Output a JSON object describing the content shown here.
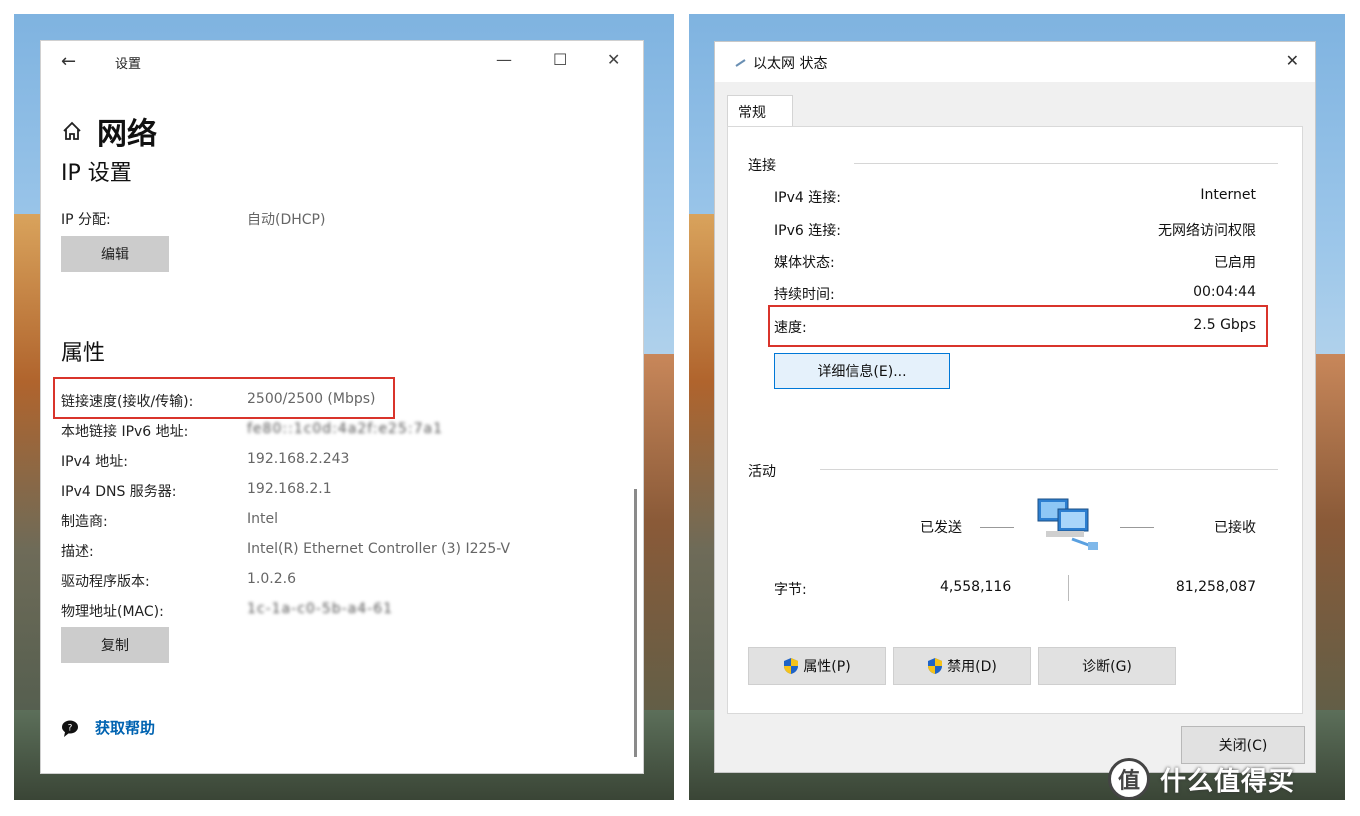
{
  "settings": {
    "title": "设置",
    "heading": "网络",
    "subheading": "IP 设置",
    "ip_assign": {
      "label": "IP 分配:",
      "value": "自动(DHCP)"
    },
    "edit_button": "编辑",
    "properties_heading": "属性",
    "props": [
      {
        "label": "链接速度(接收/传输):",
        "value": "2500/2500 (Mbps)"
      },
      {
        "label": "本地链接 IPv6 地址:",
        "value": "fe80::1c0d:4a2f:e25:7a1"
      },
      {
        "label": "IPv4 地址:",
        "value": "192.168.2.243"
      },
      {
        "label": "IPv4 DNS 服务器:",
        "value": "192.168.2.1"
      },
      {
        "label": "制造商:",
        "value": "Intel"
      },
      {
        "label": "描述:",
        "value": "Intel(R) Ethernet Controller (3) I225-V"
      },
      {
        "label": "驱动程序版本:",
        "value": "1.0.2.6"
      },
      {
        "label": "物理地址(MAC):",
        "value": "1c-1a-c0-5b-a4-61"
      }
    ],
    "copy_button": "复制",
    "help_link": "获取帮助"
  },
  "dialog": {
    "title": "以太网 状态",
    "tab": "常规",
    "connection_group": "连接",
    "connection": [
      {
        "label": "IPv4 连接:",
        "value": "Internet"
      },
      {
        "label": "IPv6 连接:",
        "value": "无网络访问权限"
      },
      {
        "label": "媒体状态:",
        "value": "已启用"
      },
      {
        "label": "持续时间:",
        "value": "00:04:44"
      },
      {
        "label": "速度:",
        "value": "2.5 Gbps"
      }
    ],
    "details_button": "详细信息(E)...",
    "activity_group": "活动",
    "sent_label": "已发送",
    "received_label": "已接收",
    "bytes_label": "字节:",
    "bytes_sent": "4,558,116",
    "bytes_received": "81,258,087",
    "properties_button": "属性(P)",
    "disable_button": "禁用(D)",
    "diagnose_button": "诊断(G)",
    "close_button": "关闭(C)"
  },
  "watermark": {
    "logo": "值",
    "text": "什么值得买"
  },
  "colors": {
    "highlight": "#d9342b",
    "link": "#0063b1",
    "focus": "#0078d7"
  }
}
